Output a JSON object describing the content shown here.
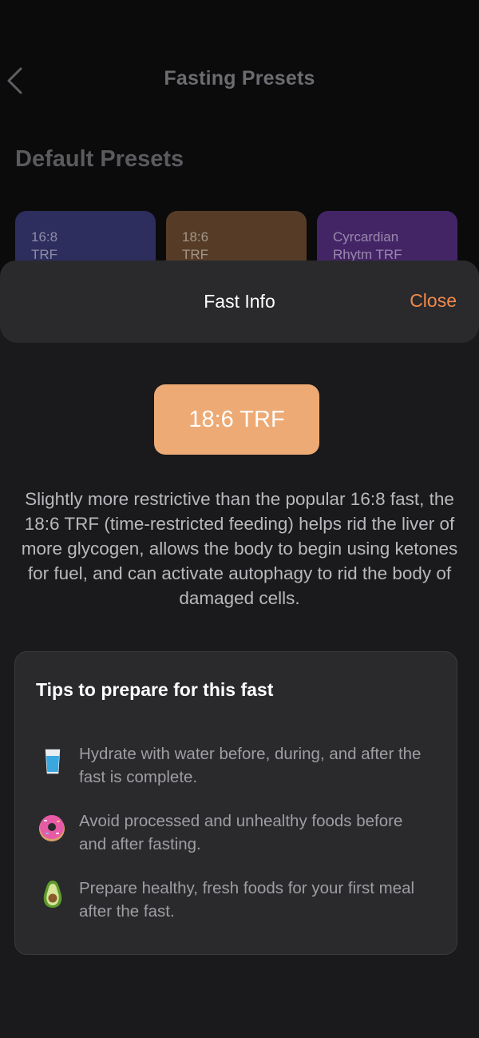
{
  "header": {
    "title": "Fasting Presets",
    "back_icon": "chevron-left-icon"
  },
  "presets": {
    "section_title": "Default Presets",
    "cards": [
      {
        "line1": "16:8",
        "line2": "TRF",
        "color": "#3b3c8f"
      },
      {
        "line1": "18:6",
        "line2": "TRF",
        "color": "#7a5030"
      },
      {
        "line1": "Cyrcardian",
        "line2": "Rhytm TRF",
        "color": "#5b2f86"
      }
    ]
  },
  "sheet": {
    "title": "Fast Info",
    "close_label": "Close",
    "fast_name": "18:6 TRF",
    "description": "Slightly more restrictive than the popular 16:8 fast, the 18:6 TRF (time-restricted feeding) helps rid the liver of more glycogen, allows the body to begin using ketones for fuel, and can activate autophagy to rid the body of damaged cells.",
    "tips": {
      "title": "Tips to prepare for this fast",
      "items": [
        {
          "icon": "water-glass-icon",
          "text": "Hydrate with water before, during, and after the fast is complete."
        },
        {
          "icon": "donut-icon",
          "text": "Avoid processed and unhealthy foods before and after fasting."
        },
        {
          "icon": "avocado-icon",
          "text": "Prepare healthy, fresh foods for your first meal after the fast."
        }
      ]
    }
  },
  "colors": {
    "accent": "#f08a4b",
    "pill": "#eeaa74",
    "sheet_bg": "#1a1a1c",
    "card_bg": "#2a2a2d"
  }
}
